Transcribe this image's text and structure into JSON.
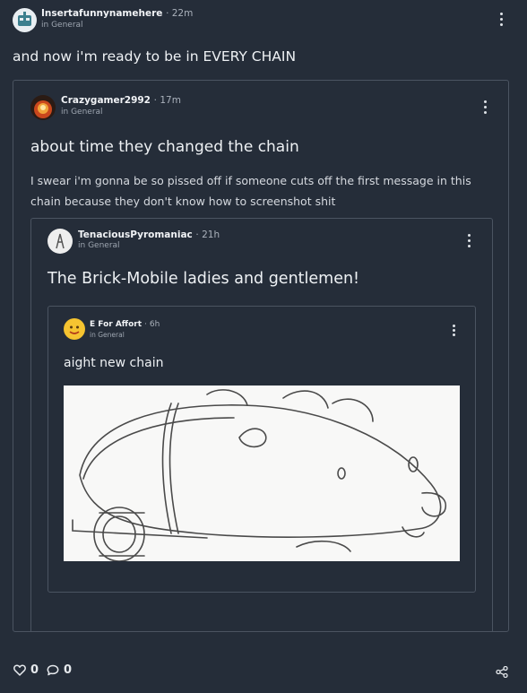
{
  "post": {
    "username": "Insertafunnynamehere",
    "time": "22m",
    "channel": "in General",
    "title": "and now i'm ready to be in EVERY CHAIN"
  },
  "quote1": {
    "username": "Crazygamer2992",
    "time": "17m",
    "channel": "in General",
    "title": "about time they changed the chain",
    "body": "I swear i'm gonna be so pissed off if someone cuts off the first message in this chain because they don't know how to screenshot shit"
  },
  "quote2": {
    "username": "TenaciousPyromaniac",
    "time": "21h",
    "channel": "in General",
    "title": "The Brick-Mobile ladies and gentlemen!"
  },
  "quote3": {
    "username": "E For Affort",
    "time": "6h",
    "channel": "in General",
    "title": "aight new chain"
  },
  "footer": {
    "likes": "0",
    "comments": "0"
  },
  "icons": {
    "kebab": "more-vertical-icon",
    "like": "heart-icon",
    "comment": "comment-icon",
    "share": "share-icon"
  }
}
